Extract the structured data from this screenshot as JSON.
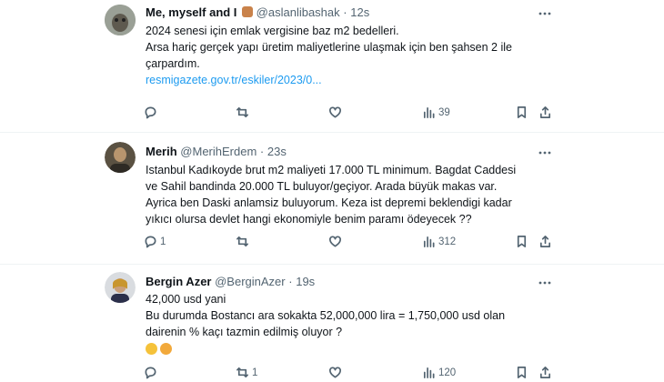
{
  "tweets": [
    {
      "name": "Me, myself and I",
      "handle": "@aslanlibashak",
      "time": "12s",
      "lines": [
        "2024 senesi için emlak vergisine baz m2 bedelleri.",
        "Arsa hariç gerçek yapı üretim maliyetlerine ulaşmak için ben şahsen 2 ile",
        "çarpardım."
      ],
      "link": "resmigazete.gov.tr/eskiler/2023/0...",
      "reply_count": "",
      "retweet_count": "",
      "view_count": "39"
    },
    {
      "name": "Merih",
      "handle": "@MerihErdem",
      "time": "23s",
      "lines": [
        "Istanbul Kadıkoyde  brut m2 maliyeti 17.000 TL minimum. Bagdat Caddesi",
        "ve Sahil bandinda 20.000 TL buluyor/geçiyor. Arada büyük makas var.",
        "Ayrica ben Daski anlamsiz buluyorum. Keza ist depremi beklendigi kadar",
        "yıkıcı olursa devlet hangi ekonomiyle benim paramı ödeyecek ??"
      ],
      "reply_count": "1",
      "retweet_count": "",
      "view_count": "312"
    },
    {
      "name": "Bergin Azer",
      "handle": "@BerginAzer",
      "time": "19s",
      "lines": [
        "42,000 usd yani",
        "Bu durumda Bostancı ara sokakta 52,000,000 lira = 1,750,000 usd olan",
        "dairenin % kaçı tazmin edilmiş oluyor ?"
      ],
      "emojis": [
        "thinking-face",
        "face-screaming"
      ],
      "reply_count": "",
      "retweet_count": "1",
      "view_count": "120"
    }
  ]
}
